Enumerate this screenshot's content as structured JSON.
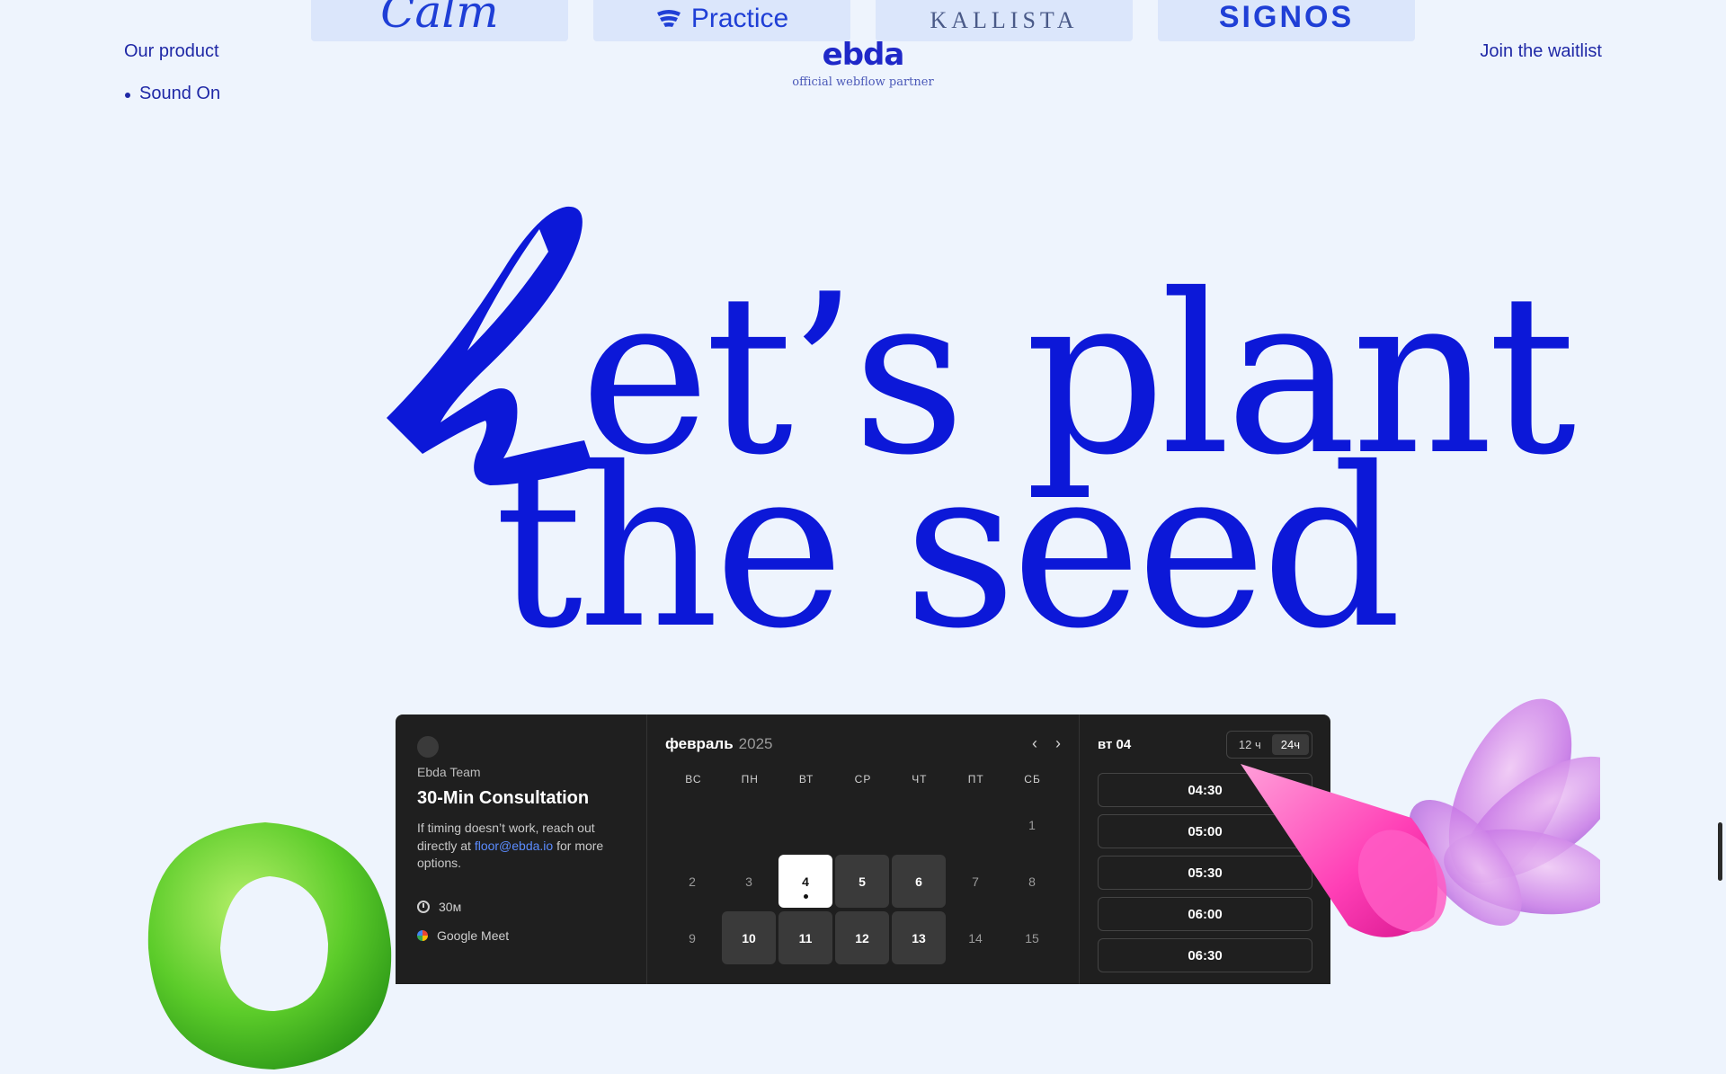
{
  "logos": [
    "Calm",
    "Practice",
    "KALLISTA",
    "SIGNOS"
  ],
  "nav": {
    "product_link": "Our product",
    "sub_items": [
      "Sound On"
    ],
    "brand_logo": "ebda",
    "brand_tagline": "official webflow partner",
    "cta": "Join the waitlist"
  },
  "hero": {
    "line1": "et’s plant",
    "line2": "the seed",
    "color": "#0c18d8"
  },
  "booking": {
    "team": "Ebda Team",
    "title": "30-Min Consultation",
    "desc_before": "If timing doesn’t work, reach out directly at ",
    "email": "floor@ebda.io",
    "desc_after": " for more options.",
    "duration": "30м",
    "location": "Google Meet",
    "month": "февраль",
    "year": "2025",
    "weekdays": [
      "ВС",
      "ПН",
      "ВТ",
      "СР",
      "ЧТ",
      "ПТ",
      "СБ"
    ],
    "days": [
      {
        "n": "",
        "state": "empty"
      },
      {
        "n": "",
        "state": "empty"
      },
      {
        "n": "",
        "state": "empty"
      },
      {
        "n": "",
        "state": "empty"
      },
      {
        "n": "",
        "state": "empty"
      },
      {
        "n": "",
        "state": "empty"
      },
      {
        "n": "1",
        "state": "off"
      },
      {
        "n": "2",
        "state": "off"
      },
      {
        "n": "3",
        "state": "off"
      },
      {
        "n": "4",
        "state": "selected"
      },
      {
        "n": "5",
        "state": "avail"
      },
      {
        "n": "6",
        "state": "avail"
      },
      {
        "n": "7",
        "state": "off"
      },
      {
        "n": "8",
        "state": "off"
      },
      {
        "n": "9",
        "state": "off"
      },
      {
        "n": "10",
        "state": "avail"
      },
      {
        "n": "11",
        "state": "avail"
      },
      {
        "n": "12",
        "state": "avail"
      },
      {
        "n": "13",
        "state": "avail"
      },
      {
        "n": "14",
        "state": "off"
      },
      {
        "n": "15",
        "state": "off"
      }
    ],
    "selected_date": "вт 04",
    "format_12": "12 ч",
    "format_24": "24ч",
    "active_format": "24ч",
    "slots": [
      "04:30",
      "05:00",
      "05:30",
      "06:00",
      "06:30"
    ]
  }
}
